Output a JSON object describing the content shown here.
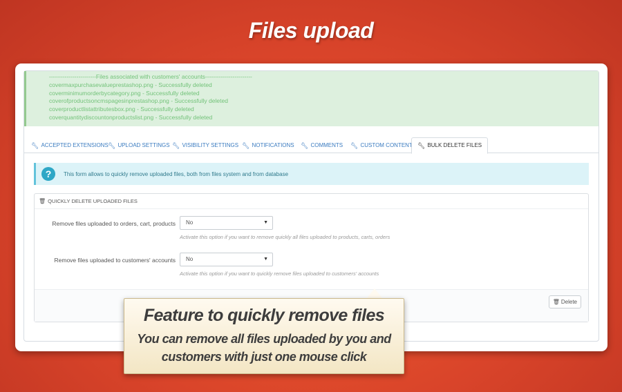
{
  "banner": {
    "title": "Files upload"
  },
  "success_log": {
    "header": "------------------------Files associated with customers' accounts------------------------",
    "lines": [
      "covermaxpurchasevalueprestashop.png - Successfully deleted",
      "coverminimumorderbycategory.png - Successfully deleted",
      "coverofproductsoncmspagesinprestashop.png - Successfully deleted",
      "coverproductlistattributesbox.png - Successfully deleted",
      "coverquantitydiscountonproductslist.png - Successfully deleted"
    ]
  },
  "tabs": [
    {
      "label": "Accepted extensions"
    },
    {
      "label": "Upload settings"
    },
    {
      "label": "Visibility settings"
    },
    {
      "label": "Notifications"
    },
    {
      "label": "Comments"
    },
    {
      "label": "Custom contents"
    },
    {
      "label": "Bulk delete files"
    }
  ],
  "active_tab": "Bulk delete files",
  "info": {
    "text": "This form allows to quickly remove uploaded files, both from files system and from database"
  },
  "panel": {
    "heading": "Quickly delete uploaded files",
    "fields": [
      {
        "label": "Remove files uploaded to orders, cart, products",
        "value": "No",
        "help": "Activate this option if you want to remove quickly all files uploaded to products, carts, orders"
      },
      {
        "label": "Remove files uploaded to customers' accounts",
        "value": "No",
        "help": "Activate this option if you want to quickly remove files uploaded to customers' accounts"
      }
    ],
    "delete_label": "Delete"
  },
  "callout": {
    "title": "Feature to quickly remove files",
    "subtitle": "You can remove all files uploaded by you and customers with just one mouse click"
  },
  "colors": {
    "background": "#d9442a",
    "success_text": "#72c279",
    "tab_link": "#3a7bc0",
    "info_bg": "#dcf3f8",
    "info_icon": "#2ea7c6"
  }
}
